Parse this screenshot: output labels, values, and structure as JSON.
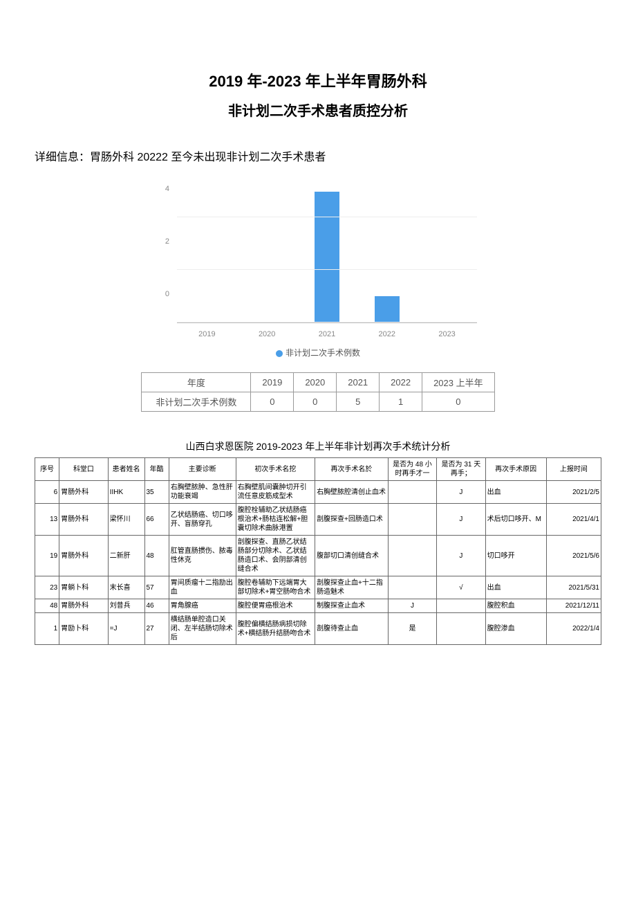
{
  "header": {
    "title1": "2019 年-2023 年上半年胃肠外科",
    "title2": "非计划二次手术患者质控分析"
  },
  "detail": {
    "label": "详细信息：",
    "text": "胃肠外科 20222 至今未出现非计划二次手术患者"
  },
  "chart_data": {
    "type": "bar",
    "categories": [
      "2019",
      "2020",
      "2021",
      "2022",
      "2023"
    ],
    "values": [
      0,
      0,
      5,
      1,
      0
    ],
    "legend": "非计划二次手术例数",
    "ylim": [
      0,
      5
    ],
    "yticks": [
      0,
      2,
      4
    ]
  },
  "summary": {
    "row_header_year": "年度",
    "row_header_count": "非计划二次手术例数",
    "cols": [
      "2019",
      "2020",
      "2021",
      "2022",
      "2023 上半年"
    ],
    "counts": [
      "0",
      "0",
      "5",
      "1",
      "0"
    ]
  },
  "detail_table": {
    "title": "山西白求恩医院 2019-2023 年上半年非计划再次手术统计分析",
    "headers": {
      "seq": "序号",
      "dept": "科堂口",
      "name": "患者姓名",
      "age": "年酷",
      "diag": "主要诊断",
      "op1": "初次手术名挖",
      "op2": "再次手术名於",
      "h48": "是否为 48 小时再手才一",
      "d31": "是否为 31 天再手；",
      "reason": "再次手术原因",
      "date": "上报时间"
    },
    "rows": [
      {
        "seq": "6",
        "dept": "胃肠外科",
        "name": "IIHK",
        "age": "35",
        "diag": "右胸壁脓肿、急性肝功能衰竭",
        "op1": "右胸壁肌间囊肿切开引流任意皮筋成型术",
        "op2": "右胸壁脓腔清创止血术",
        "h48": "",
        "d31": "J",
        "reason": "出血",
        "date": "2021/2/5"
      },
      {
        "seq": "13",
        "dept": "胃肠外科",
        "name": "梁怀川",
        "age": "66",
        "diag": "乙状结肠癌、切口哆开、盲肠穿孔",
        "op1": "腹腔栓辅助乙状结肠癌根治术+肠枯连松解+胆囊切除术曲脉港置",
        "op2": "剖腹探查+回肠造口术",
        "h48": "",
        "d31": "J",
        "reason": "术后切口哆开、M",
        "date": "2021/4/1"
      },
      {
        "seq": "19",
        "dept": "胃肠外科",
        "name": "二新肝",
        "age": "48",
        "diag": "肛管直肠掼伤、脓毒性休克",
        "op1": "剖腹探查、直肠乙状结肠部分切除术、乙状结肠造口术、会阴部清创缝合术",
        "op2": "腹部切口清创缝合术",
        "h48": "",
        "d31": "J",
        "reason": "切口哆开",
        "date": "2021/5/6"
      },
      {
        "seq": "23",
        "dept": "胃躺卜科",
        "name": "末长喜",
        "age": "57",
        "diag": "胃间质瘤十二指励出血",
        "op1": "腹腔卷辅助下远端胃大部切除术+胃空肠吻合术",
        "op2": "剖腹探查止血+十二指肠造魅术",
        "h48": "",
        "d31": "√",
        "reason": "出血",
        "date": "2021/5/31"
      },
      {
        "seq": "48",
        "dept": "胃肠外科",
        "name": "刘昔兵",
        "age": "46",
        "diag": "胃角腺癌",
        "op1": "腹腔便胃癌根治术",
        "op2": "制腹探查止血术",
        "h48": "J",
        "d31": "",
        "reason": "腹腔积血",
        "date": "2021/12/11"
      },
      {
        "seq": "1",
        "dept": "胃励卜科",
        "name": "=J",
        "age": "27",
        "diag": "横结肠单腔造口关闭、左半结肠切除术后",
        "op1": "腹腔偏横结肠病损切除术+横结肠升结肠吻合术",
        "op2": "剖腹待查止血",
        "h48": "是",
        "d31": "",
        "reason": "腹腔渗血",
        "date": "2022/1/4"
      }
    ]
  }
}
